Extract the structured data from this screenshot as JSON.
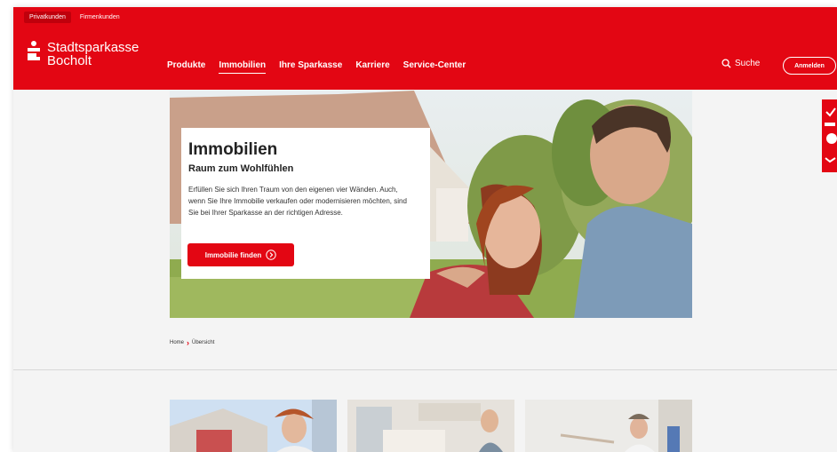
{
  "header": {
    "segments": [
      {
        "label": "Privatkunden",
        "active": true
      },
      {
        "label": "Firmenkunden",
        "active": false
      }
    ],
    "logo": {
      "line1": "Stadtsparkasse",
      "line2": "Bocholt"
    },
    "nav": [
      {
        "label": "Produkte",
        "active": false
      },
      {
        "label": "Immobilien",
        "active": true
      },
      {
        "label": "Ihre Sparkasse",
        "active": false
      },
      {
        "label": "Karriere",
        "active": false
      },
      {
        "label": "Service-Center",
        "active": false
      }
    ],
    "search_label": "Suche",
    "login_label": "Anmelden"
  },
  "hero": {
    "title": "Immobilien",
    "subtitle": "Raum zum Wohlfühlen",
    "text": "Erfüllen Sie sich Ihren Traum von den eigenen vier Wänden. Auch, wenn Sie Ihre Immobilie verkaufen oder modernisieren möchten, sind Sie bei Ihrer Sparkasse an der richtigen Adresse.",
    "button_label": "Immobilie finden"
  },
  "breadcrumb": {
    "home": "Home",
    "separator": "›",
    "current": "Übersicht"
  },
  "colors": {
    "brand": "#e30613",
    "background": "#f4f4f4"
  },
  "icons": [
    "sparkasse-logo-icon",
    "search-icon",
    "chevron-right-circle-icon"
  ]
}
